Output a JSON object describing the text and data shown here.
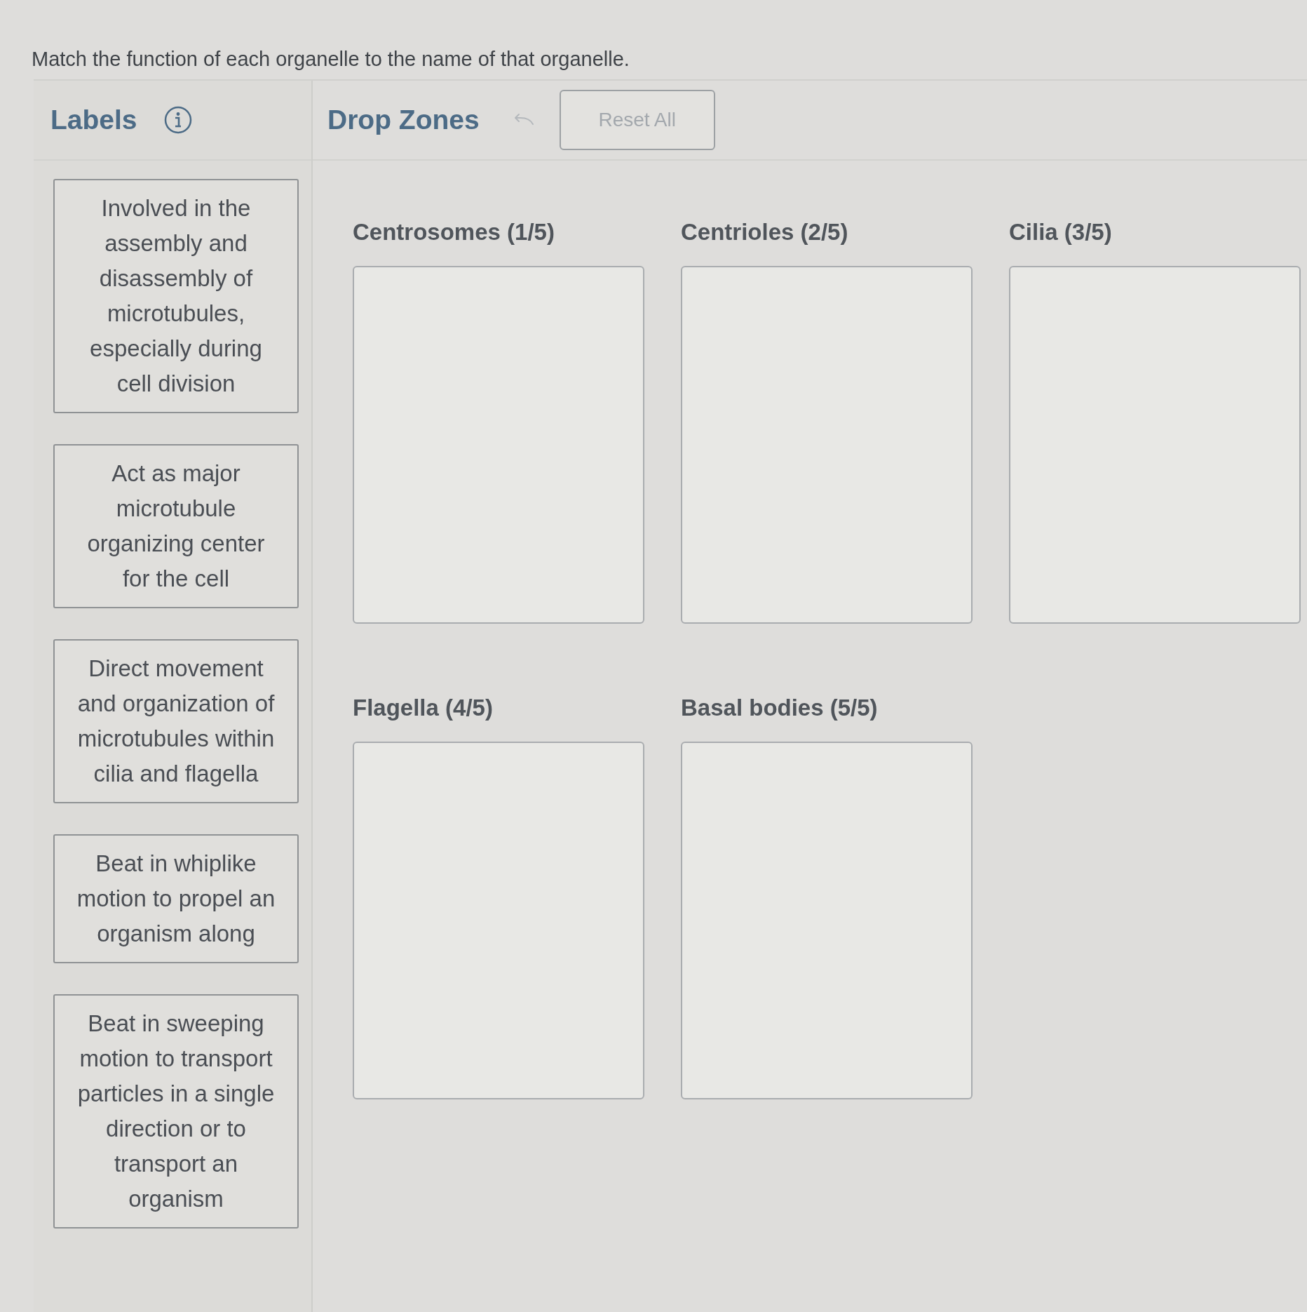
{
  "instructions": "Match the function of each organelle to the name of that organelle.",
  "labels_panel": {
    "title": "Labels"
  },
  "drop_zones_panel": {
    "title": "Drop Zones",
    "undo_button": {
      "disabled": true
    },
    "reset_button": {
      "label": "Reset All",
      "disabled": true
    }
  },
  "labels": [
    {
      "text": "Involved in the assembly and disassembly of microtubules, especially during cell division"
    },
    {
      "text": "Act as major microtubule organizing center for the cell"
    },
    {
      "text": "Direct movement and organization of microtubules within cilia and flagella"
    },
    {
      "text": "Beat in whiplike motion to propel an organism along"
    },
    {
      "text": "Beat in sweeping motion to transport particles in a single direction or to transport an organism"
    }
  ],
  "drop_zones": [
    {
      "title": "Centrosomes (1/5)"
    },
    {
      "title": "Centrioles (2/5)"
    },
    {
      "title": "Cilia (3/5)"
    },
    {
      "title": "Flagella (4/5)"
    },
    {
      "title": "Basal bodies (5/5)"
    }
  ]
}
